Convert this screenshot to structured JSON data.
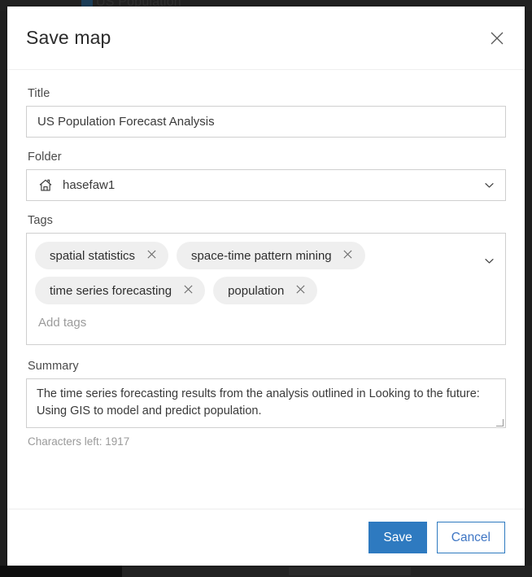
{
  "backdrop": {
    "obscured_title": "US Population"
  },
  "dialog": {
    "title": "Save map",
    "close_icon": "close-icon"
  },
  "form": {
    "title_field": {
      "label": "Title",
      "value": "US Population Forecast Analysis",
      "placeholder": ""
    },
    "folder_field": {
      "label": "Folder",
      "value": "hasefaw1",
      "icon": "home-icon",
      "chevron_icon": "chevron-down-icon"
    },
    "tags_field": {
      "label": "Tags",
      "placeholder": "Add tags",
      "value": "",
      "chevron_icon": "chevron-down-icon",
      "chips": [
        {
          "label": "spatial statistics",
          "remove_icon": "close-icon"
        },
        {
          "label": "space-time pattern mining",
          "remove_icon": "close-icon"
        },
        {
          "label": "time series forecasting",
          "remove_icon": "close-icon"
        },
        {
          "label": "population",
          "remove_icon": "close-icon"
        }
      ]
    },
    "summary_field": {
      "label": "Summary",
      "value": "The time series forecasting results from the analysis outlined in Looking to the future: Using GIS to model and predict population.",
      "placeholder": "",
      "characters_left": "Characters left: 1917",
      "resize_handle_icon": "resize-handle-icon"
    }
  },
  "footer": {
    "save_label": "Save",
    "cancel_label": "Cancel"
  },
  "colors": {
    "accent_blue": "#2e7ac0",
    "cancel_text_blue": "#3f76c4",
    "chip_gray": "#efefef",
    "border_gray": "#cfcfcf",
    "backdrop_dark": "#1e1e1e"
  }
}
